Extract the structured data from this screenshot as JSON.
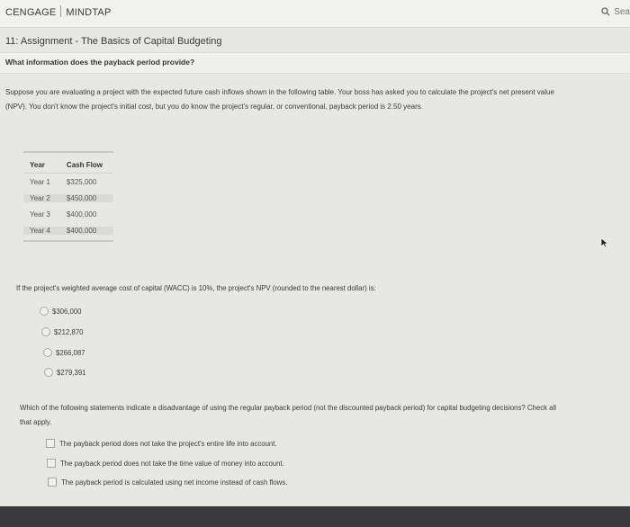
{
  "header": {
    "brand_left": "CENGAGE",
    "brand_right": "MINDTAP",
    "search_label": "Sea"
  },
  "assignment_title": "11: Assignment - The Basics of Capital Budgeting",
  "question_title": "What information does the payback period provide?",
  "intro_text": "Suppose you are evaluating a project with the expected future cash inflows shown in the following table. Your boss has asked you to calculate the project's net present value (NPV). You don't know the project's initial cost, but you do know the project's regular, or conventional, payback period is 2.50 years.",
  "cash_flow_table": {
    "headers": [
      "Year",
      "Cash Flow"
    ],
    "rows": [
      [
        "Year 1",
        "$325,000"
      ],
      [
        "Year 2",
        "$450,000"
      ],
      [
        "Year 3",
        "$400,000"
      ],
      [
        "Year 4",
        "$400,000"
      ]
    ]
  },
  "question1": {
    "text": "If the project's weighted average cost of capital (WACC) is 10%, the project's NPV (rounded to the nearest dollar) is:",
    "options": [
      "$306,000",
      "$212,870",
      "$266,087",
      "$279,391"
    ]
  },
  "question2": {
    "text": "Which of the following statements indicate a disadvantage of using the regular payback period (not the discounted payback period) for capital budgeting decisions? Check all that apply.",
    "options": [
      "The payback period does not take the project's entire life into account.",
      "The payback period does not take the time value of money into account.",
      "The payback period is calculated using net income instead of cash flows."
    ]
  }
}
